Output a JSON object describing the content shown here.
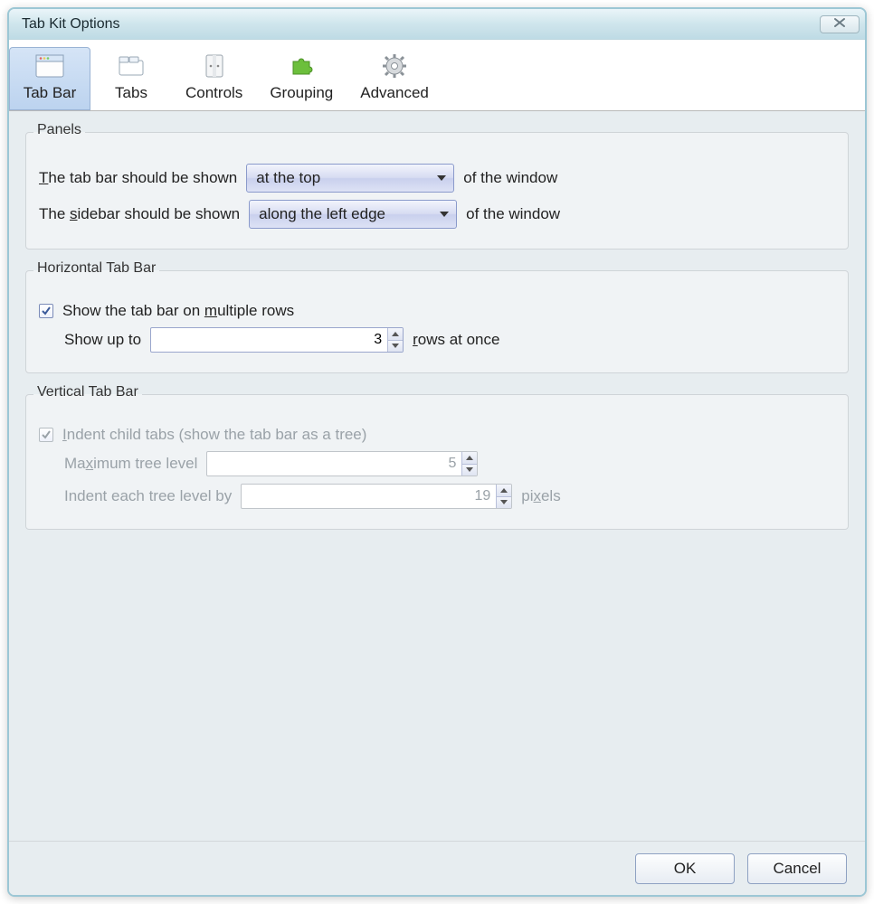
{
  "title": "Tab Kit Options",
  "toolbar": {
    "items": [
      {
        "label": "Tab Bar",
        "icon": "window-icon",
        "active": true
      },
      {
        "label": "Tabs",
        "icon": "tabs-icon",
        "active": false
      },
      {
        "label": "Controls",
        "icon": "controls-icon",
        "active": false
      },
      {
        "label": "Grouping",
        "icon": "puzzle-icon",
        "active": false
      },
      {
        "label": "Advanced",
        "icon": "gear-icon",
        "active": false
      }
    ]
  },
  "panels": {
    "legend": "Panels",
    "tabbar_pre": "The tab bar should be shown",
    "tabbar_pre_u": "T",
    "tabbar_select": "at the top",
    "tabbar_post": "of the window",
    "sidebar_pre": "The sidebar should be shown",
    "sidebar_pre_u": "s",
    "sidebar_select": "along the left edge",
    "sidebar_post": "of the window"
  },
  "horizontal": {
    "legend": "Horizontal Tab Bar",
    "chk_label_pre": "Show the tab bar on ",
    "chk_label_u": "m",
    "chk_label_post": "ultiple rows",
    "chk_checked": true,
    "rows_pre": "Show up to",
    "rows_value": "3",
    "rows_post_u": "r",
    "rows_post": "ows at once"
  },
  "vertical": {
    "legend": "Vertical Tab Bar",
    "chk_u": "I",
    "chk_label": "ndent child tabs (show the tab bar as a tree)",
    "chk_checked": true,
    "max_pre": "Ma",
    "max_u": "x",
    "max_post": "imum tree level",
    "max_value": "5",
    "indent_pre": "Indent each tree level by",
    "indent_value": "19",
    "indent_post": "pi",
    "indent_post_u": "x",
    "indent_post2": "els"
  },
  "footer": {
    "ok": "OK",
    "cancel": "Cancel"
  }
}
